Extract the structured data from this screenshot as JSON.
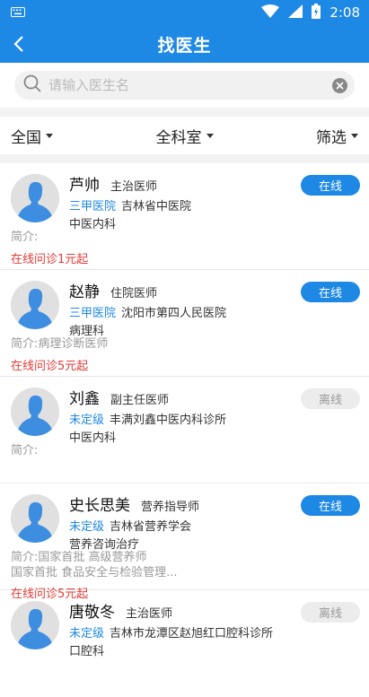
{
  "status_bar": {
    "time": "2:08"
  },
  "header": {
    "title": "找医生"
  },
  "search": {
    "placeholder": "请输入医生名",
    "value": ""
  },
  "filters": [
    {
      "label": "全国"
    },
    {
      "label": "全科室"
    },
    {
      "label": "筛选"
    }
  ],
  "colors": {
    "primary": "#1e88e5",
    "price": "#e53935",
    "offline_bg": "#ececec"
  },
  "doctors": [
    {
      "name": "芦帅",
      "rank": "主治医师",
      "level": "三甲医院",
      "hospital": "吉林省中医院",
      "dept": "中医内科",
      "status": "在线",
      "intro1": "简介:",
      "intro2": "",
      "price": "在线问诊1元起"
    },
    {
      "name": "赵静",
      "rank": "住院医师",
      "level": "三甲医院",
      "hospital": "沈阳市第四人民医院",
      "dept": "病理科",
      "status": "在线",
      "intro1": "简介:病理诊断医师",
      "intro2": "",
      "price": "在线问诊5元起"
    },
    {
      "name": "刘鑫",
      "rank": "副主任医师",
      "level": "未定级",
      "hospital": "丰满刘鑫中医内科诊所",
      "dept": "中医内科",
      "status": "离线",
      "intro1": "简介:",
      "intro2": "",
      "price": ""
    },
    {
      "name": "史长思美",
      "rank": "营养指导师",
      "level": "未定级",
      "hospital": "吉林省营养学会",
      "dept": "营养咨询治疗",
      "status": "在线",
      "intro1": "简介:国家首批 高级营养师",
      "intro2": "国家首批 食品安全与检验管理...",
      "price": "在线问诊5元起"
    },
    {
      "name": "唐敬冬",
      "rank": "主治医师",
      "level": "未定级",
      "hospital": "吉林市龙潭区赵旭红口腔科诊所",
      "dept": "口腔科",
      "status": "离线",
      "intro1": "",
      "intro2": "",
      "price": ""
    }
  ]
}
